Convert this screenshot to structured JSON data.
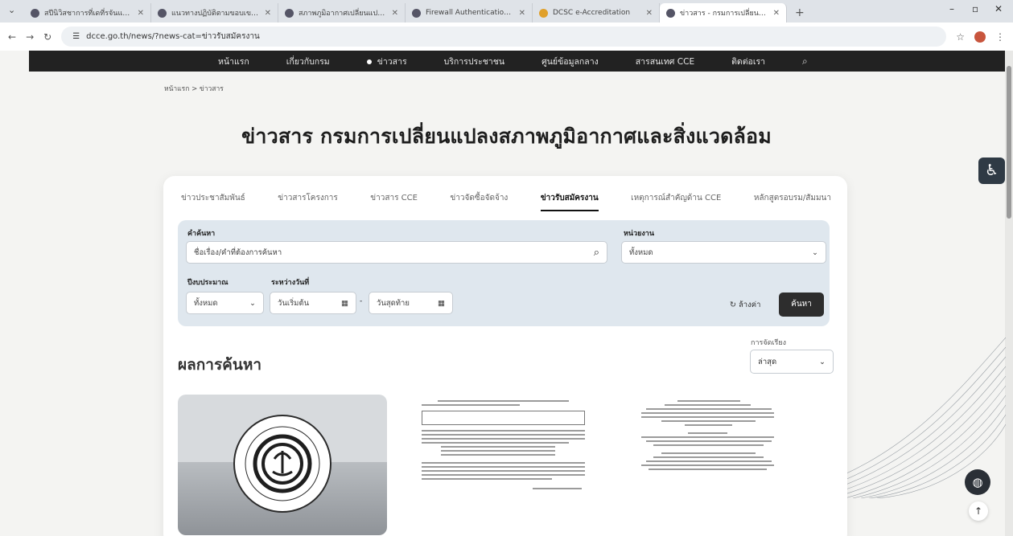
{
  "browser": {
    "tabs": [
      {
        "title": "สปีนิวิสชาการที่เดที่รจันแสดงทพ"
      },
      {
        "title": "แนวทางปฏิบัติตามขอบเขตการดำเนิน"
      },
      {
        "title": "สภาพภูมิอากาศเปลี่ยนแปลงทางพื้น"
      },
      {
        "title": "Firewall Authentication Keepali"
      },
      {
        "title": "DCSC e-Accreditation"
      },
      {
        "title": "ข่าวสาร - กรมการเปลี่ยนแปลงส"
      }
    ],
    "url": "dcce.go.th/news/?news-cat=ข่าวรับสมัครงาน"
  },
  "nav": {
    "items": [
      "หน้าแรก",
      "เกี่ยวกับกรม",
      "ข่าวสาร",
      "บริการประชาชน",
      "ศูนย์ข้อมูลกลาง",
      "สารสนเทศ CCE",
      "ติดต่อเรา"
    ]
  },
  "breadcrumb": "หน้าแรก > ข่าวสาร",
  "page_title": "ข่าวสาร กรมการเปลี่ยนแปลงสภาพภูมิอากาศและสิ่งแวดล้อม",
  "category_tabs": [
    "ข่าวประชาสัมพันธ์",
    "ข่าวสารโครงการ",
    "ข่าวสาร CCE",
    "ข่าวจัดซื้อจัดจ้าง",
    "ข่าวรับสมัครงาน",
    "เหตุการณ์สำคัญด้าน CCE",
    "หลักสูตรอบรม/สัมมนา"
  ],
  "filter": {
    "keyword_label": "คำค้นหา",
    "keyword_placeholder": "ชื่อเรื่อง/คำที่ต้องการค้นหา",
    "unit_label": "หน่วยงาน",
    "unit_value": "ทั้งหมด",
    "year_label": "ปีงบประมาณ",
    "year_value": "ทั้งหมด",
    "range_label": "ระหว่างวันที่",
    "start_placeholder": "วันเริ่มต้น",
    "end_placeholder": "วันสุดท้าย",
    "range_sep": "-",
    "clear_label": "ล้างค่า",
    "search_label": "ค้นหา"
  },
  "results": {
    "title": "ผลการค้นหา",
    "sort_label": "การจัดเรียง",
    "sort_value": "ล่าสุด"
  }
}
